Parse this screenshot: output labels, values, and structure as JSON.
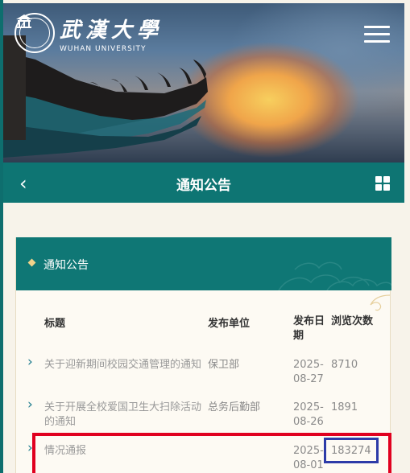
{
  "header": {
    "logo_cn": "武漢大學",
    "logo_en": "WUHAN UNIVERSITY"
  },
  "titlebar": {
    "title": "通知公告"
  },
  "section": {
    "title": "通知公告"
  },
  "table": {
    "columns": [
      "标题",
      "发布单位",
      "发布日期",
      "浏览次数"
    ],
    "rows": [
      {
        "title": "关于迎新期间校园交通管理的通知",
        "unit": "保卫部",
        "date": "2025-08-27",
        "views": "8710"
      },
      {
        "title": "关于开展全校爱国卫生大扫除活动的通知",
        "unit": "总务后勤部",
        "date": "2025-08-26",
        "views": "1891"
      },
      {
        "title": "情况通报",
        "unit": "",
        "date": "2025-08-01",
        "views": "183274"
      }
    ]
  },
  "colors": {
    "teal": "#0e7573",
    "highlight_red": "#e0001f",
    "highlight_blue": "#2d3ba8"
  }
}
